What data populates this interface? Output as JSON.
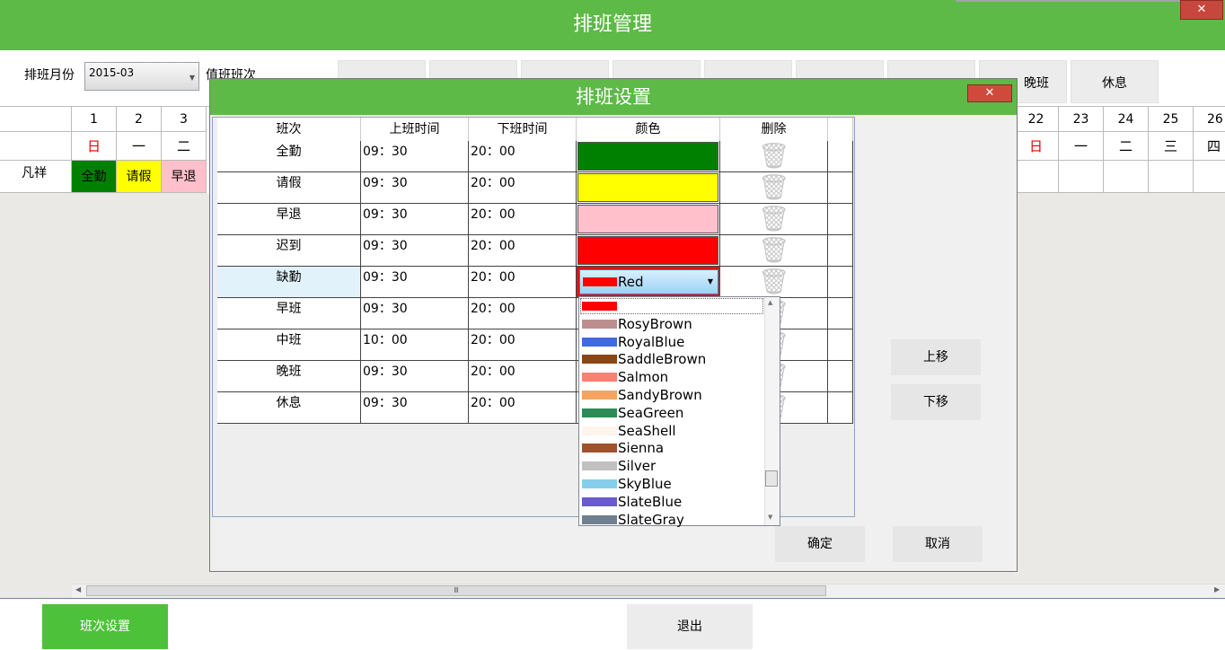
{
  "app": {
    "title": "排班管理",
    "close_glyph": "✕"
  },
  "toolbar": {
    "month_label": "排班月份",
    "month_value": "2015-03",
    "shift_label": "值班班次",
    "shift_buttons": [
      "",
      "",
      "",
      "",
      "",
      "",
      "",
      "晚班",
      "休息"
    ]
  },
  "calendar": {
    "left_days": [
      "1",
      "2",
      "3"
    ],
    "left_weekdays": [
      "日",
      "一",
      "二"
    ],
    "right_days": [
      "22",
      "23",
      "24",
      "25",
      "26"
    ],
    "right_weekdays": [
      "日",
      "一",
      "二",
      "三",
      "四"
    ],
    "employee": "凡祥",
    "left_shifts": [
      {
        "label": "全勤",
        "bg": "#008000"
      },
      {
        "label": "请假",
        "bg": "#ffff00"
      },
      {
        "label": "早退",
        "bg": "#ffc0cb"
      }
    ],
    "scroll_glyph": "Ⅲ"
  },
  "dialog": {
    "title": "排班设置",
    "close_glyph": "✕",
    "columns": [
      "班次",
      "上班时间",
      "下班时间",
      "颜色",
      "删除"
    ],
    "rows": [
      {
        "name": "全勤",
        "start": "09：30",
        "end": "20：00",
        "color": "#008000"
      },
      {
        "name": "请假",
        "start": "09：30",
        "end": "20：00",
        "color": "#ffff00"
      },
      {
        "name": "早退",
        "start": "09：30",
        "end": "20：00",
        "color": "#ffc0cb"
      },
      {
        "name": "迟到",
        "start": "09：30",
        "end": "20：00",
        "color": "#ff0000"
      },
      {
        "name": "缺勤",
        "start": "09：30",
        "end": "20：00",
        "color": "#ff0000"
      },
      {
        "name": "早班",
        "start": "09：30",
        "end": "20：00",
        "color": ""
      },
      {
        "name": "中班",
        "start": "10：00",
        "end": "20：00",
        "color": ""
      },
      {
        "name": "晚班",
        "start": "09：30",
        "end": "20：00",
        "color": ""
      },
      {
        "name": "休息",
        "start": "09：30",
        "end": "20：00",
        "color": ""
      }
    ],
    "trash_glyph": "🗑",
    "color_combo": {
      "value": "Red",
      "swatch": "#ff0000"
    },
    "color_options": [
      {
        "name": "",
        "color": "#ff0000"
      },
      {
        "name": "RosyBrown",
        "color": "#bc8f8f"
      },
      {
        "name": "RoyalBlue",
        "color": "#4169e1"
      },
      {
        "name": "SaddleBrown",
        "color": "#8b4513"
      },
      {
        "name": "Salmon",
        "color": "#fa8072"
      },
      {
        "name": "SandyBrown",
        "color": "#f4a460"
      },
      {
        "name": "SeaGreen",
        "color": "#2e8b57"
      },
      {
        "name": "SeaShell",
        "color": "#fff5ee"
      },
      {
        "name": "Sienna",
        "color": "#a0522d"
      },
      {
        "name": "Silver",
        "color": "#c0c0c0"
      },
      {
        "name": "SkyBlue",
        "color": "#87ceeb"
      },
      {
        "name": "SlateBlue",
        "color": "#6a5acd"
      },
      {
        "name": "SlateGray",
        "color": "#708090"
      }
    ],
    "move_up": "上移",
    "move_down": "下移",
    "ok": "确定",
    "cancel": "取消"
  },
  "footer": {
    "shift_settings": "班次设置",
    "exit": "退出"
  }
}
